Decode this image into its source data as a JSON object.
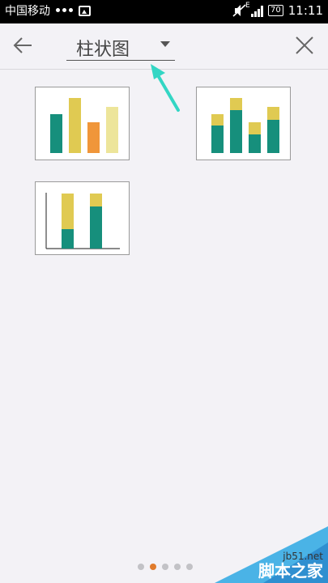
{
  "status_bar": {
    "carrier": "中国移动",
    "signal_type": "E",
    "battery": "70",
    "time": "11:11"
  },
  "header": {
    "chart_type_label": "柱状图",
    "back_icon": "arrow-left-icon",
    "close_icon": "close-icon",
    "dropdown_icon": "caret-down-icon"
  },
  "chart_styles": [
    {
      "style": "clustered-columns"
    },
    {
      "style": "stacked-columns"
    },
    {
      "style": "stacked-columns-with-axes"
    }
  ],
  "pager": {
    "pages": 5,
    "active_index": 1
  },
  "colors": {
    "teal": "#168f7c",
    "mustard": "#e0ca52",
    "orange": "#f0963a",
    "pale_yellow": "#ede59a",
    "annotation_arrow": "#33d6c4",
    "active_dot": "#e07b2c"
  },
  "watermark": {
    "site": "jb51.net",
    "brand": "脚本之家"
  }
}
